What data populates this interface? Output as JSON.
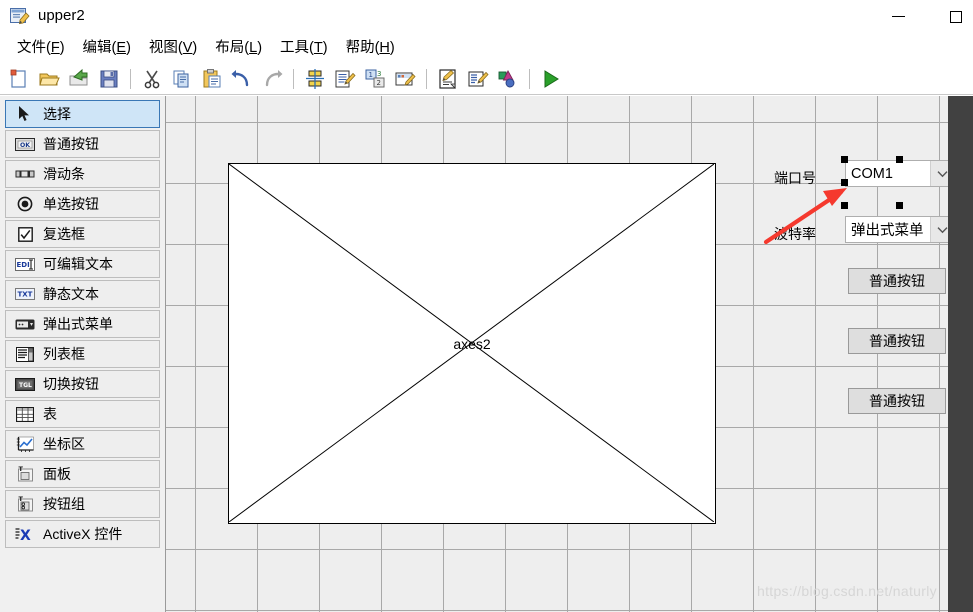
{
  "window": {
    "title": "upper2",
    "icon": "guide-figure-icon",
    "buttons": [
      {
        "name": "minimize-button",
        "glyph": "minimize-icon"
      },
      {
        "name": "maximize-button",
        "glyph": "maximize-icon"
      }
    ]
  },
  "menubar": {
    "items": [
      {
        "label": "文件(F)",
        "text": "文件",
        "accel": "F"
      },
      {
        "label": "编辑(E)",
        "text": "编辑",
        "accel": "E"
      },
      {
        "label": "视图(V)",
        "text": "视图",
        "accel": "V"
      },
      {
        "label": "布局(L)",
        "text": "布局",
        "accel": "L"
      },
      {
        "label": "工具(T)",
        "text": "工具",
        "accel": "T"
      },
      {
        "label": "帮助(H)",
        "text": "帮助",
        "accel": "H"
      }
    ]
  },
  "toolbar": {
    "items": [
      {
        "name": "new-figure-button",
        "icon": "new-document-icon"
      },
      {
        "name": "open-button",
        "icon": "open-folder-icon"
      },
      {
        "name": "export-button",
        "icon": "export-arrow-icon"
      },
      {
        "name": "save-button",
        "icon": "floppy-save-icon"
      },
      {
        "name": "separator-1",
        "icon": "separator"
      },
      {
        "name": "cut-button",
        "icon": "scissors-icon"
      },
      {
        "name": "copy-button",
        "icon": "copy-pages-icon"
      },
      {
        "name": "paste-button",
        "icon": "paste-clipboard-icon"
      },
      {
        "name": "undo-button",
        "icon": "undo-arrow-icon"
      },
      {
        "name": "redo-button",
        "icon": "redo-arrow-icon"
      },
      {
        "name": "separator-2",
        "icon": "separator"
      },
      {
        "name": "align-objects-button",
        "icon": "align-grid-icon"
      },
      {
        "name": "menu-editor-button",
        "icon": "menu-editor-icon"
      },
      {
        "name": "tab-order-editor-button",
        "icon": "tab-order-icon"
      },
      {
        "name": "toolbar-editor-button",
        "icon": "toolbar-editor-icon"
      },
      {
        "name": "separator-3",
        "icon": "separator"
      },
      {
        "name": "m-file-editor-button",
        "icon": "m-file-editor-icon"
      },
      {
        "name": "property-inspector-button",
        "icon": "property-inspector-icon"
      },
      {
        "name": "object-browser-button",
        "icon": "object-browser-icon"
      },
      {
        "name": "separator-4",
        "icon": "separator"
      },
      {
        "name": "run-button",
        "icon": "run-play-icon"
      }
    ]
  },
  "palette": {
    "items": [
      {
        "label": "选择",
        "icon": "cursor-arrow-icon",
        "selected": true
      },
      {
        "label": "普通按钮",
        "icon": "push-button-icon",
        "selected": false
      },
      {
        "label": "滑动条",
        "icon": "slider-icon",
        "selected": false
      },
      {
        "label": "单选按钮",
        "icon": "radio-button-icon",
        "selected": false
      },
      {
        "label": "复选框",
        "icon": "checkbox-icon",
        "selected": false
      },
      {
        "label": "可编辑文本",
        "icon": "edit-text-icon",
        "selected": false
      },
      {
        "label": "静态文本",
        "icon": "static-text-icon",
        "selected": false
      },
      {
        "label": "弹出式菜单",
        "icon": "popup-menu-icon",
        "selected": false
      },
      {
        "label": "列表框",
        "icon": "listbox-icon",
        "selected": false
      },
      {
        "label": "切换按钮",
        "icon": "toggle-button-icon",
        "selected": false
      },
      {
        "label": "表",
        "icon": "table-icon",
        "selected": false
      },
      {
        "label": "坐标区",
        "icon": "axes-icon",
        "selected": false
      },
      {
        "label": "面板",
        "icon": "panel-icon",
        "selected": false
      },
      {
        "label": "按钮组",
        "icon": "button-group-icon",
        "selected": false
      },
      {
        "label": "ActiveX 控件",
        "icon": "activex-icon",
        "selected": false
      }
    ]
  },
  "canvas": {
    "axes": {
      "label": "axes2",
      "name": "axes2-object"
    },
    "labels": [
      {
        "name": "port-number-label",
        "text": "端口号"
      },
      {
        "name": "baud-rate-label",
        "text": "波特率"
      }
    ],
    "popups": [
      {
        "name": "port-number-popup",
        "value": "COM1",
        "selected": true
      },
      {
        "name": "baud-rate-popup",
        "value": "弹出式菜单",
        "selected": false
      }
    ],
    "buttons": [
      {
        "name": "push-button-1",
        "label": "普通按钮"
      },
      {
        "name": "push-button-2",
        "label": "普通按钮"
      },
      {
        "name": "push-button-3",
        "label": "普通按钮"
      }
    ],
    "annotation": {
      "name": "red-arrow-annotation",
      "color": "#f5392e"
    }
  },
  "watermark": {
    "text": "https://blog.csdn.net/naturly"
  },
  "colors": {
    "selection_blue": "#cfe5f7",
    "selection_border": "#3a77b5",
    "canvas_bg": "#eeeeee",
    "grid_line": "#a8a8a8",
    "rail_dark": "#414141",
    "annotation_red": "#f5392e"
  }
}
